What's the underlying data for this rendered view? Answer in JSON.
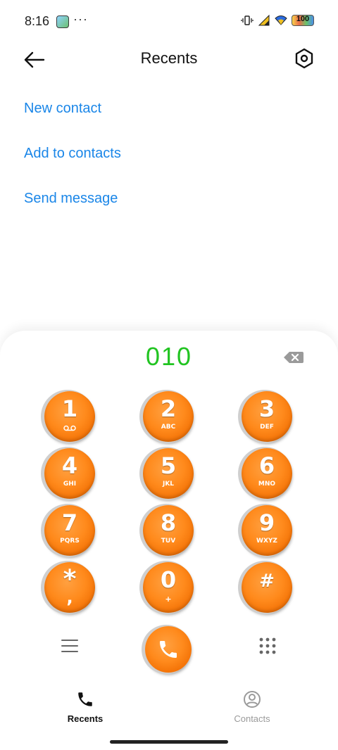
{
  "status_bar": {
    "time": "8:16",
    "more": "···",
    "battery": "100"
  },
  "header": {
    "title": "Recents"
  },
  "actions": {
    "new_contact": "New contact",
    "add_to_contacts": "Add to contacts",
    "send_message": "Send message"
  },
  "dialer": {
    "number": "010",
    "keys": [
      {
        "digit": "1",
        "letters": ""
      },
      {
        "digit": "2",
        "letters": "ABC"
      },
      {
        "digit": "3",
        "letters": "DEF"
      },
      {
        "digit": "4",
        "letters": "GHI"
      },
      {
        "digit": "5",
        "letters": "JKL"
      },
      {
        "digit": "6",
        "letters": "MNO"
      },
      {
        "digit": "7",
        "letters": "PQRS"
      },
      {
        "digit": "8",
        "letters": "TUV"
      },
      {
        "digit": "9",
        "letters": "WXYZ"
      },
      {
        "digit": "*",
        "letters": ","
      },
      {
        "digit": "0",
        "letters": "+"
      },
      {
        "digit": "#",
        "letters": ""
      }
    ]
  },
  "nav": {
    "recents": "Recents",
    "contacts": "Contacts"
  },
  "colors": {
    "accent_link": "#1a86e8",
    "dialed_number": "#21c421",
    "key_orange": "#ff8a1c"
  },
  "icons": [
    "back-arrow-icon",
    "settings-hexagon-icon",
    "backspace-icon",
    "voicemail-icon",
    "menu-icon",
    "phone-icon",
    "keypad-grid-icon",
    "contact-icon"
  ]
}
